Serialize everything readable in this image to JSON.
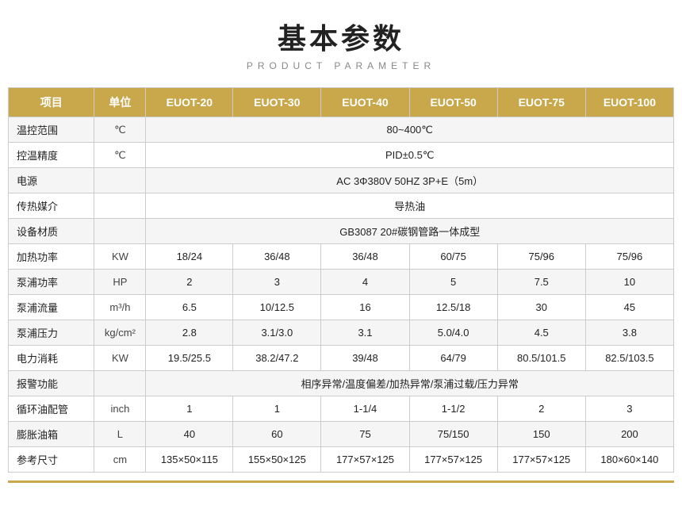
{
  "title": {
    "main": "基本参数",
    "sub": "PRODUCT PARAMETER"
  },
  "table": {
    "headers": [
      "项目",
      "单位",
      "EUOT-20",
      "EUOT-30",
      "EUOT-40",
      "EUOT-50",
      "EUOT-75",
      "EUOT-100"
    ],
    "rows": [
      {
        "label": "温控范围",
        "unit": "℃",
        "span": true,
        "span_value": "80~400℃",
        "values": []
      },
      {
        "label": "控温精度",
        "unit": "℃",
        "span": true,
        "span_value": "PID±0.5℃",
        "values": []
      },
      {
        "label": "电源",
        "unit": "",
        "span": true,
        "span_value": "AC 3Φ380V 50HZ 3P+E（5m）",
        "values": []
      },
      {
        "label": "传热媒介",
        "unit": "",
        "span": true,
        "span_value": "导热油",
        "values": []
      },
      {
        "label": "设备材质",
        "unit": "",
        "span": true,
        "span_value": "GB3087   20#碳钢管路一体成型",
        "values": []
      },
      {
        "label": "加热功率",
        "unit": "KW",
        "span": false,
        "values": [
          "18/24",
          "36/48",
          "36/48",
          "60/75",
          "75/96",
          "75/96"
        ]
      },
      {
        "label": "泵浦功率",
        "unit": "HP",
        "span": false,
        "values": [
          "2",
          "3",
          "4",
          "5",
          "7.5",
          "10"
        ]
      },
      {
        "label": "泵浦流量",
        "unit": "m³/h",
        "span": false,
        "values": [
          "6.5",
          "10/12.5",
          "16",
          "12.5/18",
          "30",
          "45"
        ]
      },
      {
        "label": "泵浦压力",
        "unit": "kg/cm²",
        "span": false,
        "values": [
          "2.8",
          "3.1/3.0",
          "3.1",
          "5.0/4.0",
          "4.5",
          "3.8"
        ]
      },
      {
        "label": "电力消耗",
        "unit": "KW",
        "span": false,
        "values": [
          "19.5/25.5",
          "38.2/47.2",
          "39/48",
          "64/79",
          "80.5/101.5",
          "82.5/103.5"
        ]
      },
      {
        "label": "报警功能",
        "unit": "",
        "span": true,
        "span_value": "相序异常/温度偏差/加热异常/泵浦过载/压力异常",
        "values": []
      },
      {
        "label": "循环油配管",
        "unit": "inch",
        "span": false,
        "values": [
          "1",
          "1",
          "1-1/4",
          "1-1/2",
          "2",
          "3"
        ]
      },
      {
        "label": "膨胀油箱",
        "unit": "L",
        "span": false,
        "values": [
          "40",
          "60",
          "75",
          "75/150",
          "150",
          "200"
        ]
      },
      {
        "label": "参考尺寸",
        "unit": "cm",
        "span": false,
        "values": [
          "135×50×115",
          "155×50×125",
          "177×57×125",
          "177×57×125",
          "177×57×125",
          "180×60×140"
        ]
      }
    ]
  }
}
